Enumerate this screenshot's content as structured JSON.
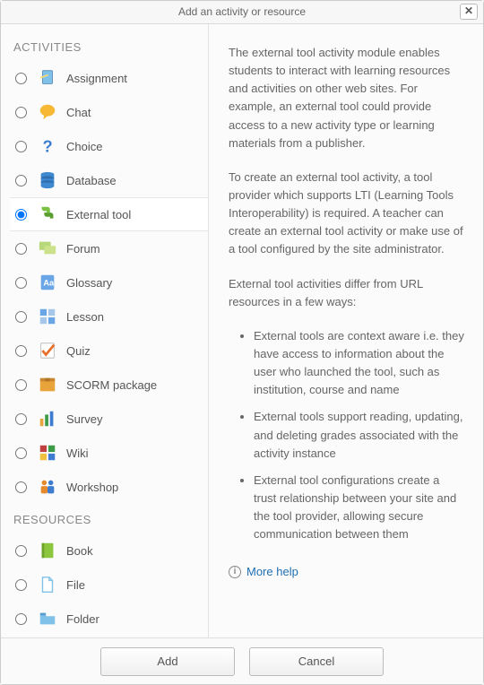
{
  "header": {
    "title": "Add an activity or resource"
  },
  "sections": {
    "activities": {
      "label": "ACTIVITIES",
      "items": [
        {
          "key": "assignment",
          "label": "Assignment"
        },
        {
          "key": "chat",
          "label": "Chat"
        },
        {
          "key": "choice",
          "label": "Choice"
        },
        {
          "key": "database",
          "label": "Database"
        },
        {
          "key": "external-tool",
          "label": "External tool",
          "selected": true
        },
        {
          "key": "forum",
          "label": "Forum"
        },
        {
          "key": "glossary",
          "label": "Glossary"
        },
        {
          "key": "lesson",
          "label": "Lesson"
        },
        {
          "key": "quiz",
          "label": "Quiz"
        },
        {
          "key": "scorm",
          "label": "SCORM package"
        },
        {
          "key": "survey",
          "label": "Survey"
        },
        {
          "key": "wiki",
          "label": "Wiki"
        },
        {
          "key": "workshop",
          "label": "Workshop"
        }
      ]
    },
    "resources": {
      "label": "RESOURCES",
      "items": [
        {
          "key": "book",
          "label": "Book"
        },
        {
          "key": "file",
          "label": "File"
        },
        {
          "key": "folder",
          "label": "Folder"
        }
      ]
    }
  },
  "description": {
    "p1": "The external tool activity module enables students to interact with learning resources and activities on other web sites. For example, an external tool could provide access to a new activity type or learning materials from a publisher.",
    "p2": "To create an external tool activity, a tool provider which supports LTI (Learning Tools Interoperability) is required. A teacher can create an external tool activity or make use of a tool configured by the site administrator.",
    "p3": "External tool activities differ from URL resources in a few ways:",
    "bullets": [
      "External tools are context aware i.e. they have access to information about the user who launched the tool, such as institution, course and name",
      "External tools support reading, updating, and deleting grades associated with the activity instance",
      "External tool configurations create a trust relationship between your site and the tool provider, allowing secure communication between them"
    ],
    "more_help_label": "More help"
  },
  "footer": {
    "add_label": "Add",
    "cancel_label": "Cancel"
  },
  "icon_colors": {
    "assignment": "#7fc1e8",
    "chat": "#f7b836",
    "choice": "#3d7ccf",
    "database": "#3e89cf",
    "external-tool": "#7ac142",
    "forum": "#cbe18b",
    "glossary": "#6aa5e6",
    "lesson": "#6aa5e6",
    "quiz": "#e8702a",
    "scorm": "#e8a33a",
    "survey": "#3c9b46",
    "wiki": "#c04040",
    "workshop": "#e68a2e",
    "book": "#8cc63e",
    "file": "#7fc1e8",
    "folder": "#7fc1e8"
  }
}
